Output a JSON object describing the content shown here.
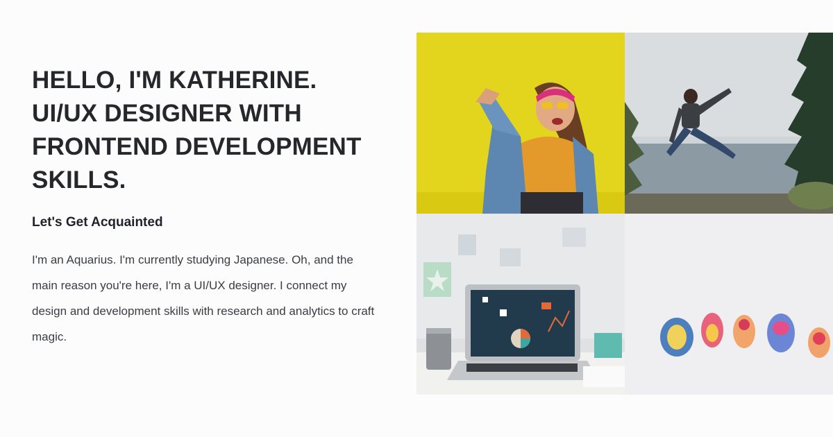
{
  "hero": {
    "headline_lines": [
      "HELLO, I'M KATHERINE.",
      "UI/UX DESIGNER WITH",
      "FRONTEND DEVELOPMENT",
      "SKILLS."
    ],
    "subheading": "Let's Get Acquainted",
    "bio": "I'm an Aquarius. I'm currently studying Japanese. Oh, and the main reason you're here, I'm a UI/UX designer. I connect my design and development skills with research and analytics to craft magic."
  },
  "gallery": {
    "images": [
      "woman-laughing-yellow-wall-photo",
      "person-jumping-lakeside-photo",
      "laptop-on-desk-photo",
      "painted-nail-tips-photo"
    ]
  },
  "colors": {
    "background": "#fcfcfd",
    "text": "#25272b",
    "yellow": "#e6d61a"
  }
}
